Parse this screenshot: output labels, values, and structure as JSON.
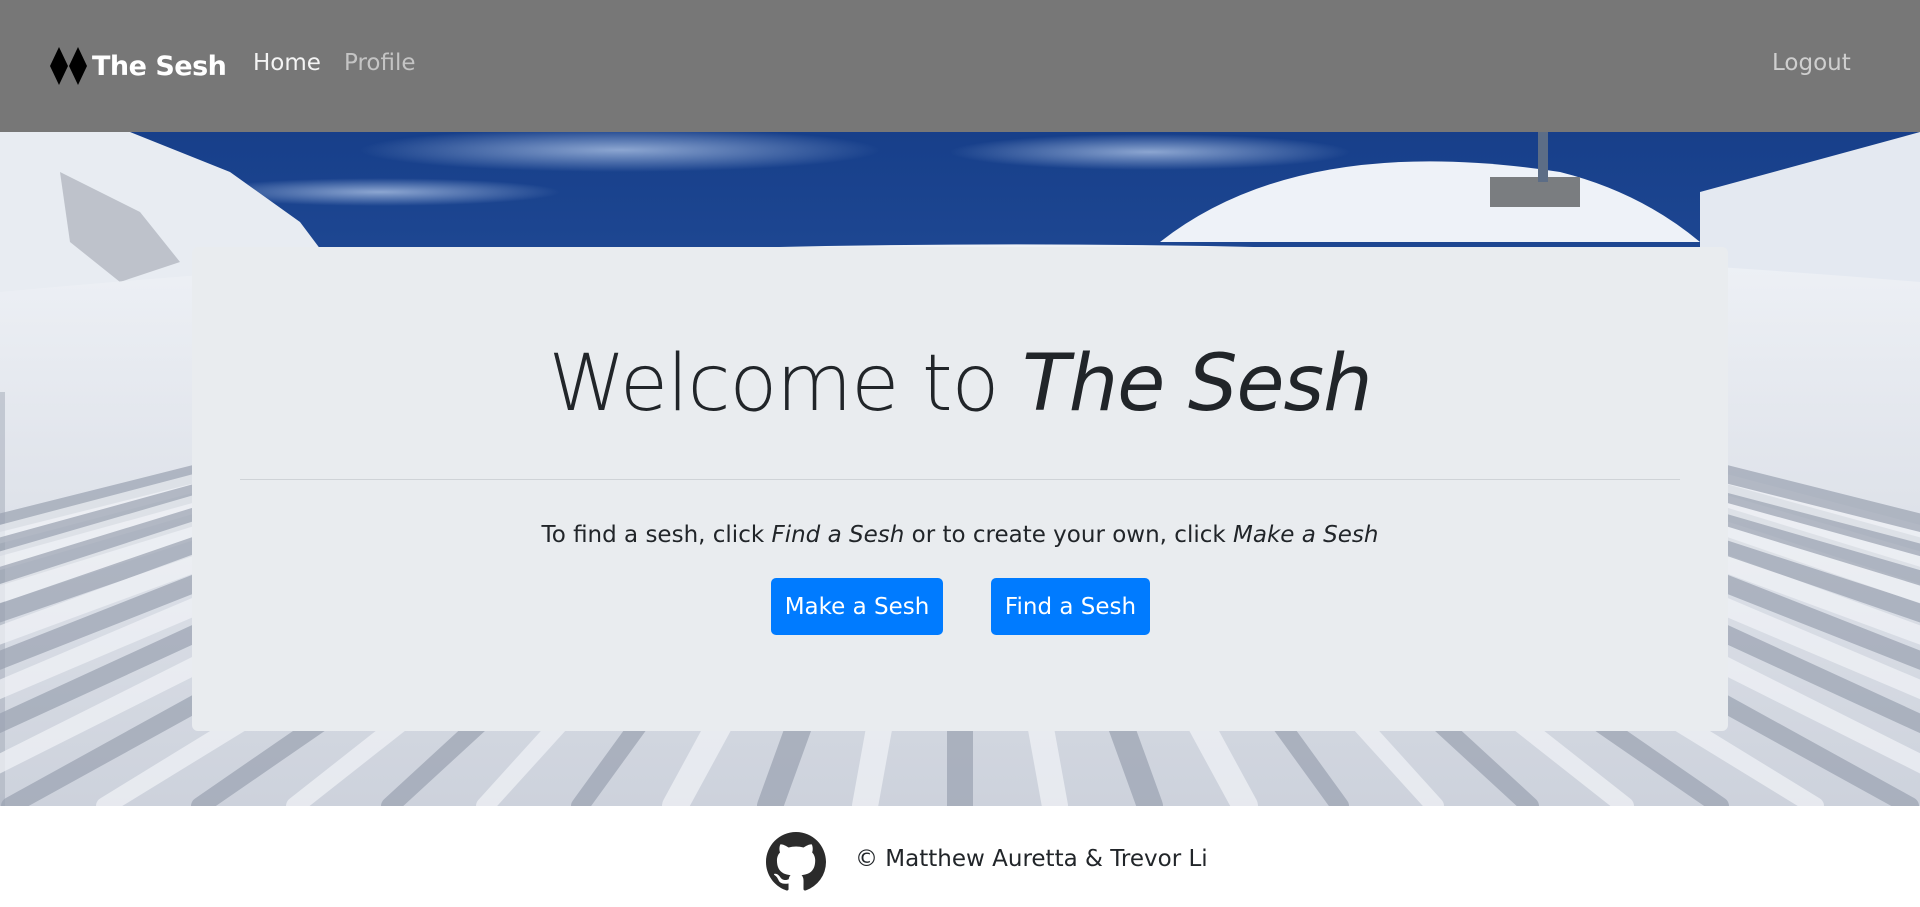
{
  "navbar": {
    "brand": "The Sesh",
    "links": {
      "home": "Home",
      "profile": "Profile",
      "logout": "Logout"
    },
    "colors": {
      "background": "#777777",
      "active": "#f4f4f4",
      "inactive": "#c4c4c4"
    },
    "brand_icon": "double-black-diamond-icon"
  },
  "hero": {
    "background_image": "groomed-ski-slope-corduroy"
  },
  "jumbotron": {
    "title_plain": "Welcome to",
    "title_emphasis": "The Sesh",
    "lead_prefix": "To find a sesh, click",
    "lead_find": "Find a Sesh",
    "lead_middle": "or to create your own, click",
    "lead_make": "Make a Sesh",
    "buttons": {
      "make": "Make a Sesh",
      "find": "Find a Sesh"
    },
    "colors": {
      "card": "#e9ecef",
      "button": "#007bff"
    }
  },
  "footer": {
    "icon": "github-icon",
    "copyright": "© Matthew Auretta & Trevor Li"
  }
}
